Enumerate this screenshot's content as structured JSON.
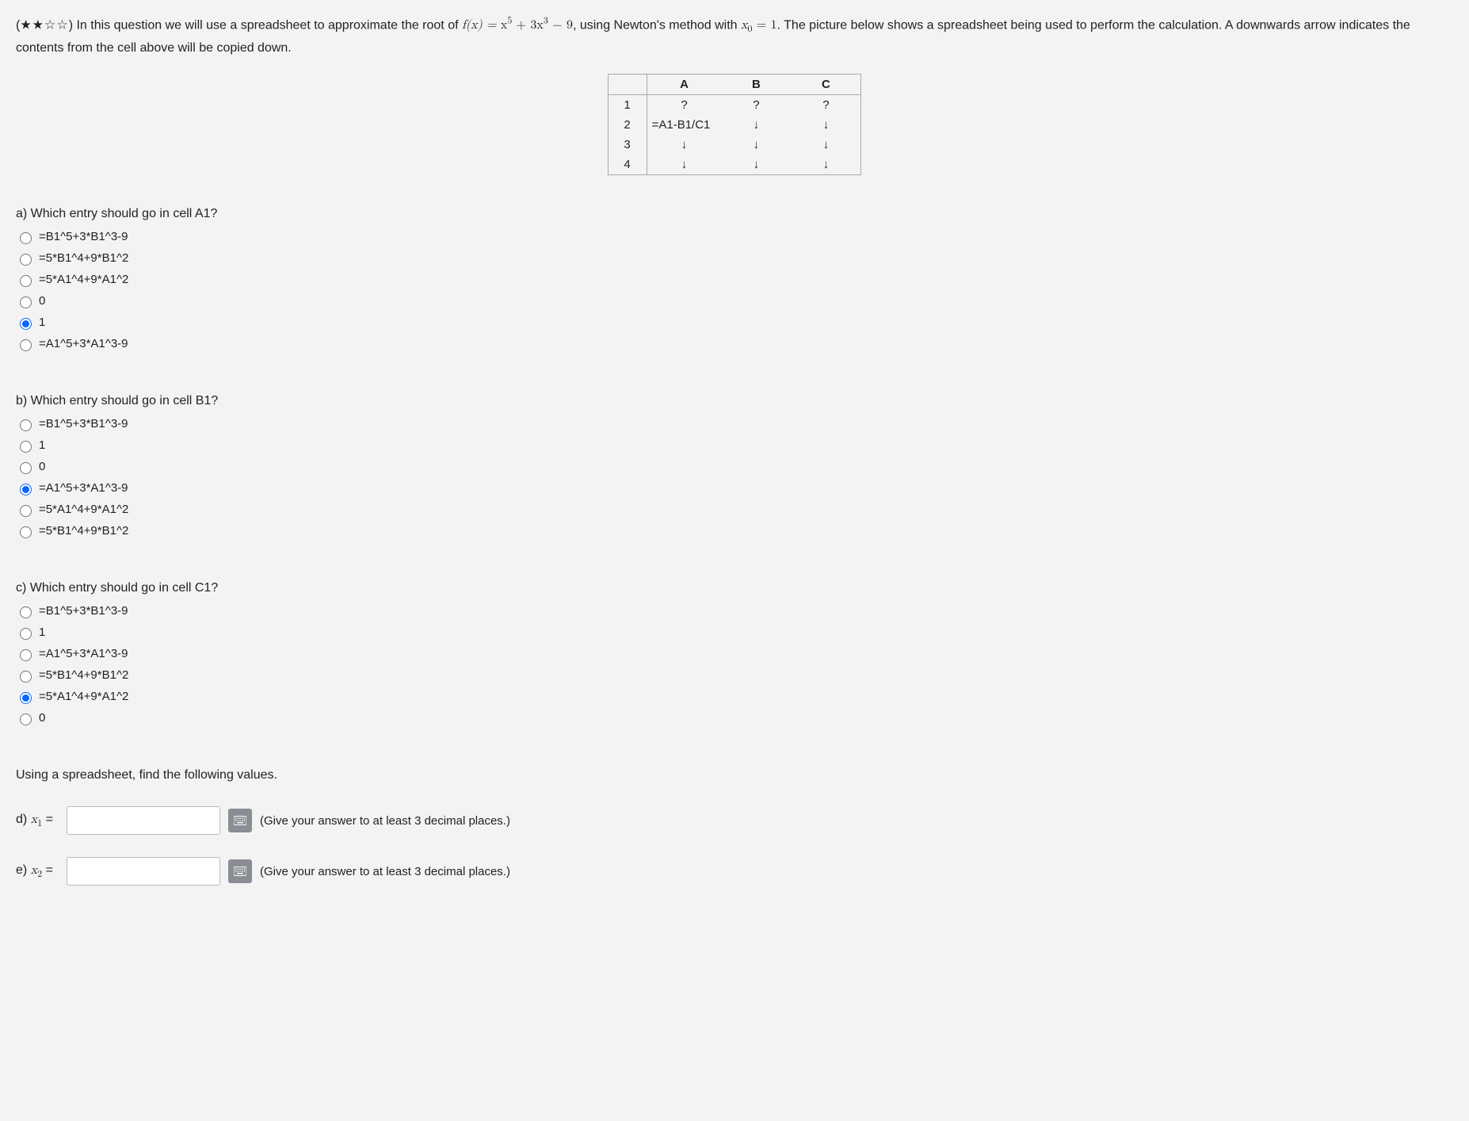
{
  "header": {
    "stars_filled": "★★",
    "stars_empty": "☆☆",
    "intro_pre": "In this question we will use a spreadsheet to approximate the root of ",
    "func_lhs": "f(x) = ",
    "func_rhs": "x⁵ + 3x³ − 9",
    "intro_mid": ", using Newton's method with ",
    "x0_lhs": "x",
    "x0_sub": "0",
    "x0_rhs": " = 1",
    "intro_post": ". The picture below shows a spreadsheet being used to perform the calculation. A downwards arrow indicates the contents from the cell above will be copied down."
  },
  "sheet": {
    "cols": [
      "A",
      "B",
      "C"
    ],
    "rows": [
      {
        "num": "1",
        "A": "?",
        "B": "?",
        "C": "?"
      },
      {
        "num": "2",
        "A": "=A1-B1/C1",
        "B": "↓",
        "C": "↓"
      },
      {
        "num": "3",
        "A": "↓",
        "B": "↓",
        "C": "↓"
      },
      {
        "num": "4",
        "A": "↓",
        "B": "↓",
        "C": "↓"
      }
    ]
  },
  "questions": {
    "a": {
      "prompt": "a) Which entry should go in cell A1?",
      "options": [
        "=B1^5+3*B1^3-9",
        "=5*B1^4+9*B1^2",
        "=5*A1^4+9*A1^2",
        "0",
        "1",
        "=A1^5+3*A1^3-9"
      ],
      "selected": 4
    },
    "b": {
      "prompt": "b) Which entry should go in cell B1?",
      "options": [
        "=B1^5+3*B1^3-9",
        "1",
        "0",
        "=A1^5+3*A1^3-9",
        "=5*A1^4+9*A1^2",
        "=5*B1^4+9*B1^2"
      ],
      "selected": 3
    },
    "c": {
      "prompt": "c) Which entry should go in cell C1?",
      "options": [
        "=B1^5+3*B1^3-9",
        "1",
        "=A1^5+3*A1^3-9",
        "=5*B1^4+9*B1^2",
        "=5*A1^4+9*A1^2",
        "0"
      ],
      "selected": 4
    }
  },
  "followup_text": "Using a spreadsheet, find the following values.",
  "numeric": {
    "d": {
      "label_pre": "d) ",
      "var": "x",
      "sub": "1",
      "eq": " = ",
      "value": "",
      "hint": "(Give your answer to at least 3 decimal places.)"
    },
    "e": {
      "label_pre": "e) ",
      "var": "x",
      "sub": "2",
      "eq": " = ",
      "value": "",
      "hint": "(Give your answer to at least 3 decimal places.)"
    }
  }
}
